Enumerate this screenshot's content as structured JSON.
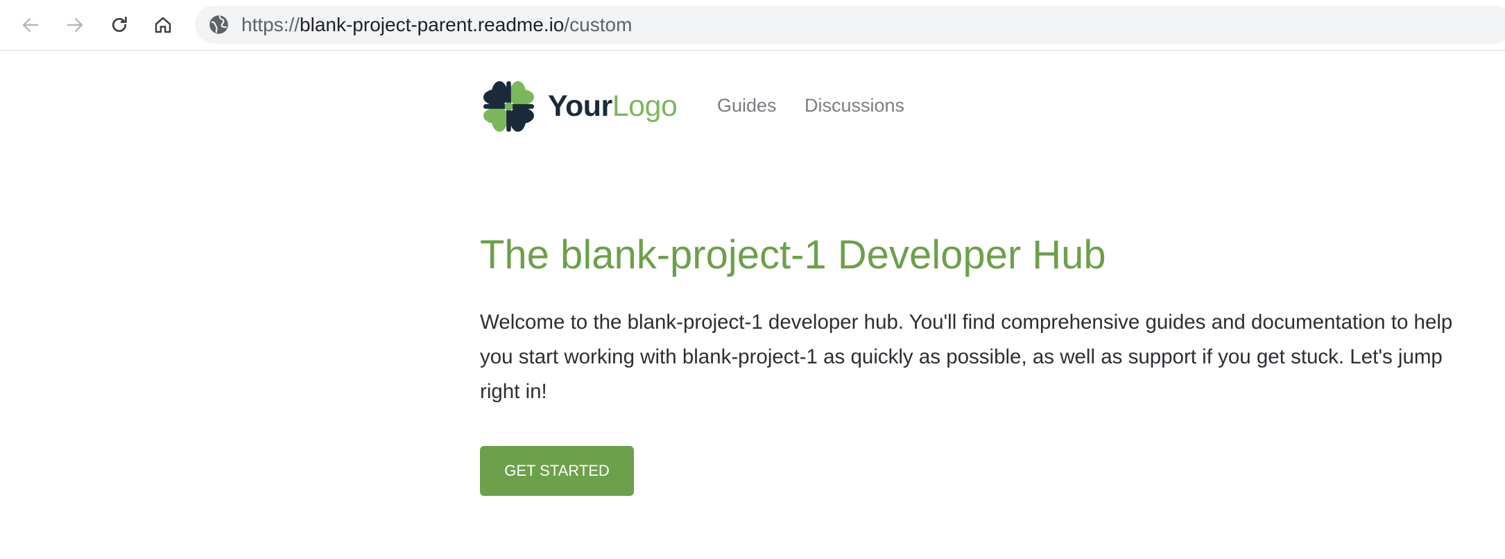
{
  "browser": {
    "url_prefix": "https://",
    "url_host": "blank-project-parent.readme.io",
    "url_path": "/custom"
  },
  "header": {
    "logo_bold": "Your",
    "logo_light": "Logo",
    "nav": [
      {
        "label": "Guides"
      },
      {
        "label": "Discussions"
      }
    ]
  },
  "hero": {
    "title": "The blank-project-1 Developer Hub",
    "body": "Welcome to the blank-project-1 developer hub. You'll find comprehensive guides and documentation to help you start working with blank-project-1 as quickly as possible, as well as support if you get stuck. Let's jump right in!",
    "button_label": "GET STARTED"
  },
  "colors": {
    "accent_green": "#6da04a",
    "logo_dark": "#1b2a3b",
    "logo_green": "#7cb85b",
    "nav_gray": "#7a7e83"
  },
  "icons": {
    "back": "back-arrow-icon",
    "forward": "forward-arrow-icon",
    "reload": "reload-icon",
    "home": "home-icon",
    "site": "globe-icon",
    "logo": "clover-logo-icon"
  }
}
